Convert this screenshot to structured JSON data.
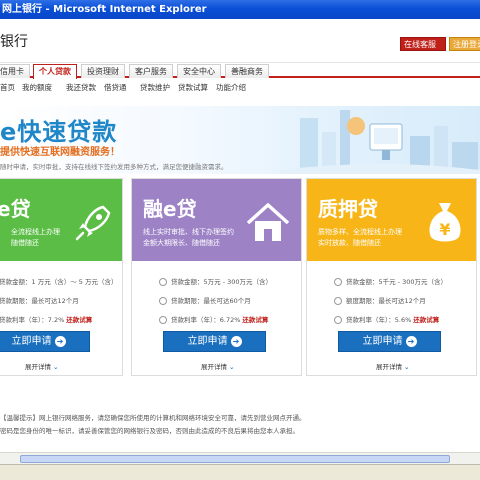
{
  "window": {
    "title": "网上银行 - Microsoft Internet Explorer"
  },
  "header": {
    "logo_text": "银行",
    "login_button": "在线客服",
    "enroll_button": "注册登录"
  },
  "nav": {
    "tabs": [
      "信用卡",
      "个人贷款",
      "投资理财",
      "客户服务",
      "安全中心",
      "善融商务"
    ],
    "active_index": 1
  },
  "subnav": {
    "items": [
      "首页",
      "我的额度",
      "我还贷款",
      "借贷通",
      "贷款维护",
      "贷款试算",
      "功能介绍"
    ]
  },
  "banner": {
    "title": "e快速贷款",
    "subtitle": "提供快速互联网融资服务！",
    "desc": "随时申请，实时审批，支持在线线下签约发用多种方式，满足您便捷融资需求。"
  },
  "cards": [
    {
      "title": "e贷",
      "desc_line1": "全流程线上办理",
      "desc_line2": "随借随还",
      "amount": "贷款金额：1 万元（含）～ 5 万元（含）",
      "term": "贷款期限：最长可达12个月",
      "rate": "贷款利率（年）：7.2%",
      "rate_link": "还款试算",
      "apply": "立即申请",
      "expand": "展开详情",
      "color": "#5bbd45"
    },
    {
      "title": "融e贷",
      "desc_line1": "线上实时审批、线下办理签约",
      "desc_line2": "金额大期限长、随借随还",
      "amount": "贷款金额：5万元 - 300万元（含）",
      "term": "贷款期限：最长可达60个月",
      "rate": "贷款利率（年）：6.72%",
      "rate_link": "还款试算",
      "apply": "立即申请",
      "expand": "展开详情",
      "color": "#9d82c6"
    },
    {
      "title": "质押贷",
      "desc_line1": "质物多样、全流程线上办理",
      "desc_line2": "实时放款、随借随还",
      "amount": "贷款金额：5千元 - 300万元（含）",
      "term": "额度期限：最长可达12个月",
      "rate": "贷款利率（年）：5.6%",
      "rate_link": "还款试算",
      "apply": "立即申请",
      "expand": "展开详情",
      "color": "#f7b518"
    }
  ],
  "notice": {
    "line1": "【温馨提示】网上银行网络服务，请您确保您所使用的计算机和网络环境安全可靠，请先到营业网点开通。",
    "line2": "密码是您身份的唯一标识，请妥善保管您的网络银行及密码，否则由此造成的不良后果将由您本人承担。"
  }
}
